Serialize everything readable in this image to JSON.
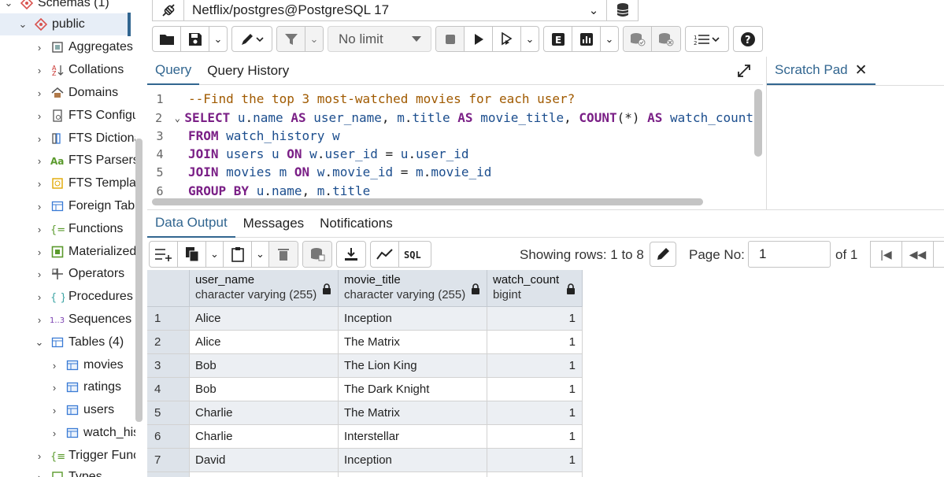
{
  "tree": {
    "items": [
      {
        "label": "Schemas (1)",
        "icon": "schemas-icon",
        "level": 0,
        "expanded": true
      },
      {
        "label": "public",
        "icon": "schema-icon",
        "level": 1,
        "expanded": true,
        "selected": true
      },
      {
        "label": "Aggregates",
        "icon": "aggregates-icon",
        "level": 2
      },
      {
        "label": "Collations",
        "icon": "collations-icon",
        "level": 2
      },
      {
        "label": "Domains",
        "icon": "domains-icon",
        "level": 2
      },
      {
        "label": "FTS Configurations",
        "icon": "fts-config-icon",
        "level": 2
      },
      {
        "label": "FTS Dictionaries",
        "icon": "fts-dictionary-icon",
        "level": 2
      },
      {
        "label": "FTS Parsers",
        "icon": "fts-parser-icon",
        "level": 2
      },
      {
        "label": "FTS Templates",
        "icon": "fts-template-icon",
        "level": 2
      },
      {
        "label": "Foreign Tables",
        "icon": "foreign-table-icon",
        "level": 2
      },
      {
        "label": "Functions",
        "icon": "functions-icon",
        "level": 2
      },
      {
        "label": "Materialized Views",
        "icon": "materialized-view-icon",
        "level": 2
      },
      {
        "label": "Operators",
        "icon": "operators-icon",
        "level": 2
      },
      {
        "label": "Procedures",
        "icon": "procedures-icon",
        "level": 2
      },
      {
        "label": "Sequences",
        "icon": "sequences-icon",
        "level": 2
      },
      {
        "label": "Tables (4)",
        "icon": "tables-icon",
        "level": 2,
        "expanded": true
      },
      {
        "label": "movies",
        "icon": "table-icon",
        "level": 3
      },
      {
        "label": "ratings",
        "icon": "table-icon",
        "level": 3
      },
      {
        "label": "users",
        "icon": "table-icon",
        "level": 3
      },
      {
        "label": "watch_history",
        "icon": "table-icon",
        "level": 3
      },
      {
        "label": "Trigger Functions",
        "icon": "trigger-function-icon",
        "level": 2
      },
      {
        "label": "Types",
        "icon": "types-icon",
        "level": 2
      }
    ]
  },
  "connection": {
    "label": "Netflix/postgres@PostgreSQL 17"
  },
  "toolbar": {
    "limit_label": "No limit"
  },
  "query_tabs": {
    "query": "Query",
    "history": "Query History",
    "scratch": "Scratch Pad",
    "scratch_close": "✕"
  },
  "editor": {
    "lines": [
      {
        "n": "1",
        "text": "--Find the top 3 most-watched movies for each user?"
      },
      {
        "n": "2",
        "text": "SELECT u.name AS user_name, m.title AS movie_title, COUNT(*) AS watch_count"
      },
      {
        "n": "3",
        "text": "FROM watch_history w"
      },
      {
        "n": "4",
        "text": "JOIN users u ON w.user_id = u.user_id"
      },
      {
        "n": "5",
        "text": "JOIN movies m ON w.movie_id = m.movie_id"
      },
      {
        "n": "6",
        "text": "GROUP BY u.name, m.title"
      }
    ]
  },
  "output_tabs": {
    "data": "Data Output",
    "messages": "Messages",
    "notifications": "Notifications"
  },
  "pagination": {
    "showing": "Showing rows: 1 to 8",
    "page_label": "Page No:",
    "page_value": "1",
    "of_label": "of 1"
  },
  "grid": {
    "columns": [
      {
        "name": "user_name",
        "type": "character varying (255)"
      },
      {
        "name": "movie_title",
        "type": "character varying (255)"
      },
      {
        "name": "watch_count",
        "type": "bigint"
      }
    ],
    "rows": [
      {
        "n": "1",
        "user_name": "Alice",
        "movie_title": "Inception",
        "watch_count": "1"
      },
      {
        "n": "2",
        "user_name": "Alice",
        "movie_title": "The Matrix",
        "watch_count": "1"
      },
      {
        "n": "3",
        "user_name": "Bob",
        "movie_title": "The Lion King",
        "watch_count": "1"
      },
      {
        "n": "4",
        "user_name": "Bob",
        "movie_title": "The Dark Knight",
        "watch_count": "1"
      },
      {
        "n": "5",
        "user_name": "Charlie",
        "movie_title": "The Matrix",
        "watch_count": "1"
      },
      {
        "n": "6",
        "user_name": "Charlie",
        "movie_title": "Interstellar",
        "watch_count": "1"
      },
      {
        "n": "7",
        "user_name": "David",
        "movie_title": "Inception",
        "watch_count": "1"
      }
    ]
  },
  "colors": {
    "accent": "#326690",
    "keyword": "#7a1f86",
    "comment": "#a05a00",
    "identifier": "#1c4e8e",
    "header_bg": "#dde3ea"
  }
}
